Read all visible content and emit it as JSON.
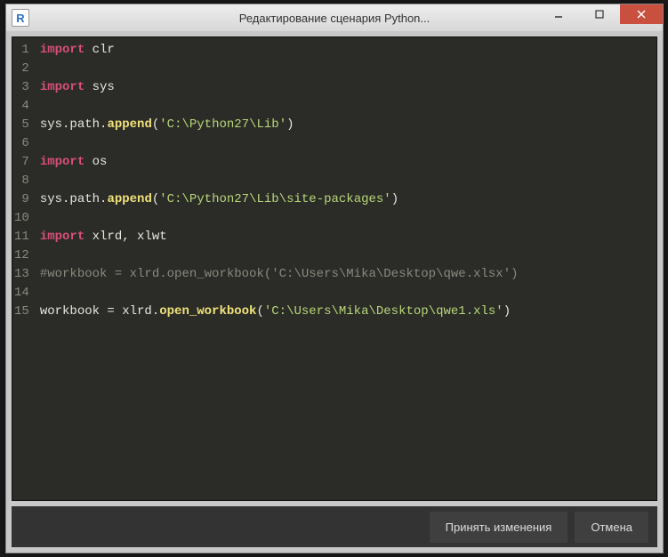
{
  "window": {
    "app_icon_letter": "R",
    "title": "Редактирование сценария Python..."
  },
  "code": {
    "lines": [
      {
        "n": 1,
        "tokens": [
          {
            "t": "import ",
            "c": "kw"
          },
          {
            "t": "clr",
            "c": "plain"
          }
        ]
      },
      {
        "n": 2,
        "tokens": []
      },
      {
        "n": 3,
        "tokens": [
          {
            "t": "import ",
            "c": "kw"
          },
          {
            "t": "sys",
            "c": "plain"
          }
        ]
      },
      {
        "n": 4,
        "tokens": []
      },
      {
        "n": 5,
        "tokens": [
          {
            "t": "sys.path.",
            "c": "plain"
          },
          {
            "t": "append",
            "c": "fn"
          },
          {
            "t": "(",
            "c": "plain"
          },
          {
            "t": "'C:\\Python27\\Lib'",
            "c": "str"
          },
          {
            "t": ")",
            "c": "plain"
          }
        ]
      },
      {
        "n": 6,
        "tokens": []
      },
      {
        "n": 7,
        "tokens": [
          {
            "t": "import ",
            "c": "kw"
          },
          {
            "t": "os",
            "c": "plain"
          }
        ]
      },
      {
        "n": 8,
        "tokens": []
      },
      {
        "n": 9,
        "tokens": [
          {
            "t": "sys.path.",
            "c": "plain"
          },
          {
            "t": "append",
            "c": "fn"
          },
          {
            "t": "(",
            "c": "plain"
          },
          {
            "t": "'C:\\Python27\\Lib\\site-packages'",
            "c": "str"
          },
          {
            "t": ")",
            "c": "plain"
          }
        ]
      },
      {
        "n": 10,
        "tokens": []
      },
      {
        "n": 11,
        "tokens": [
          {
            "t": "import ",
            "c": "kw"
          },
          {
            "t": "xlrd, xlwt",
            "c": "plain"
          }
        ]
      },
      {
        "n": 12,
        "tokens": []
      },
      {
        "n": 13,
        "tokens": [
          {
            "t": "#workbook = xlrd.open_workbook('C:\\Users\\Mika\\Desktop\\qwe.xlsx')",
            "c": "cmt"
          }
        ]
      },
      {
        "n": 14,
        "tokens": []
      },
      {
        "n": 15,
        "tokens": [
          {
            "t": "workbook = xlrd.",
            "c": "plain"
          },
          {
            "t": "open_workbook",
            "c": "fn"
          },
          {
            "t": "(",
            "c": "plain"
          },
          {
            "t": "'C:\\Users\\Mika\\Desktop\\qwe1.xls'",
            "c": "str"
          },
          {
            "t": ")",
            "c": "plain"
          }
        ]
      }
    ],
    "cursor": {
      "line": 15,
      "col": 44
    }
  },
  "footer": {
    "accept_label": "Принять изменения",
    "cancel_label": "Отмена"
  }
}
